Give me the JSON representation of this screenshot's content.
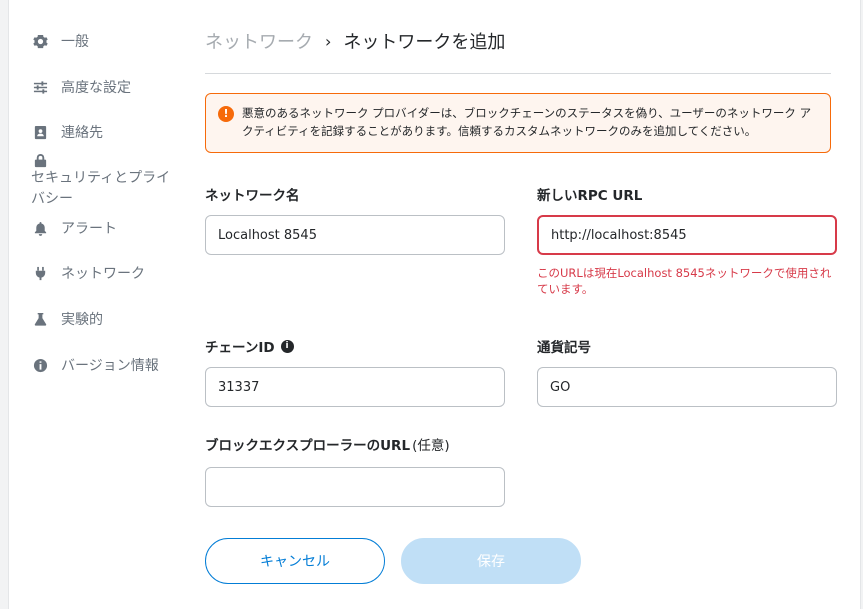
{
  "sidebar": {
    "items": [
      {
        "label": "一般",
        "icon": "gear-icon"
      },
      {
        "label": "高度な設定",
        "icon": "sliders-icon"
      },
      {
        "label": "連絡先",
        "icon": "contact-book-icon"
      },
      {
        "label": "セキュリティとプライバシー",
        "icon": "lock-icon"
      },
      {
        "label": "アラート",
        "icon": "bell-icon"
      },
      {
        "label": "ネットワーク",
        "icon": "plug-icon"
      },
      {
        "label": "実験的",
        "icon": "flask-icon"
      },
      {
        "label": "バージョン情報",
        "icon": "info-icon"
      }
    ]
  },
  "breadcrumb": {
    "parent": "ネットワーク",
    "separator": "›",
    "current": "ネットワークを追加"
  },
  "warning": {
    "icon": "!",
    "text": "悪意のあるネットワーク プロバイダーは、ブロックチェーンのステータスを偽り、ユーザーのネットワーク アクティビティを記録することがあります。信頼するカスタムネットワークのみを追加してください。"
  },
  "form": {
    "network_name": {
      "label": "ネットワーク名",
      "value": "Localhost 8545"
    },
    "rpc_url": {
      "label": "新しいRPC URL",
      "value": "http://localhost:8545",
      "error": "このURLは現在Localhost 8545ネットワークで使用されています。"
    },
    "chain_id": {
      "label": "チェーンID",
      "info": "i",
      "value": "31337"
    },
    "currency_symbol": {
      "label": "通貨記号",
      "value": "GO"
    },
    "explorer_url": {
      "label": "ブロックエクスプローラーのURL",
      "optional": "(任意)",
      "value": ""
    }
  },
  "buttons": {
    "cancel": "キャンセル",
    "save": "保存"
  },
  "colors": {
    "accent": "#037dd6",
    "error": "#d73a49",
    "warning": "#f66a0a"
  }
}
